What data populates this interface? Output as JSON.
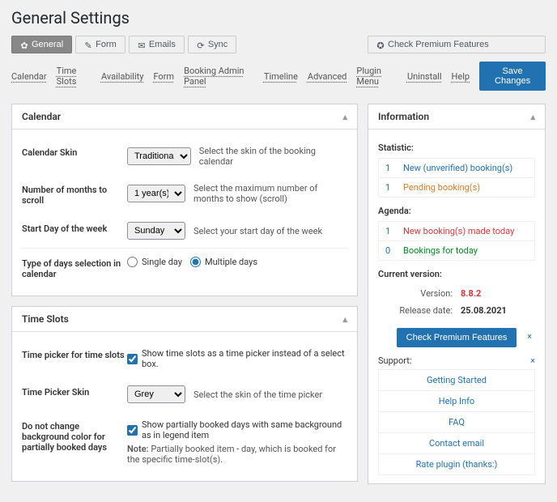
{
  "page_title": "General Settings",
  "tabs": {
    "general": "General",
    "form": "Form",
    "emails": "Emails",
    "sync": "Sync",
    "premium": "Check Premium Features"
  },
  "subnav": [
    "Calendar",
    "Time Slots",
    "Availability",
    "Form",
    "Booking Admin Panel",
    "Timeline",
    "Advanced",
    "Plugin Menu",
    "Uninstall",
    "Help"
  ],
  "save_label": "Save Changes",
  "calendar": {
    "title": "Calendar",
    "skin": {
      "label": "Calendar Skin",
      "value": "Traditional",
      "hint": "Select the skin of the booking calendar"
    },
    "months": {
      "label": "Number of months to scroll",
      "value": "1 year(s)",
      "hint": "Select the maximum number of months to show (scroll)"
    },
    "startday": {
      "label": "Start Day of the week",
      "value": "Sunday",
      "hint": "Select your start day of the week"
    },
    "daytype": {
      "label": "Type of days selection in calendar",
      "opt_single": "Single day",
      "opt_multi": "Multiple days"
    }
  },
  "timeslots": {
    "title": "Time Slots",
    "picker": {
      "label": "Time picker for time slots",
      "desc": "Show time slots as a time picker instead of a select box."
    },
    "skin": {
      "label": "Time Picker Skin",
      "value": "Grey",
      "hint": "Select the skin of the time picker"
    },
    "bg": {
      "label": "Do not change background color for partially booked days",
      "desc": "Show partially booked days with same background as in legend item",
      "note_b": "Note:",
      "note_t": " Partially booked item - day, which is booked for the specific time-slot(s)."
    }
  },
  "info": {
    "title": "Information",
    "stat_h": "Statistic:",
    "stat": [
      {
        "n": "1",
        "t": "New (unverified) booking(s)",
        "c": "blue"
      },
      {
        "n": "1",
        "t": "Pending booking(s)",
        "c": "orange"
      }
    ],
    "agenda_h": "Agenda:",
    "agenda": [
      {
        "n": "1",
        "t": "New booking(s) made today",
        "c": "red"
      },
      {
        "n": "0",
        "t": "Bookings for today",
        "c": "green"
      }
    ],
    "ver_h": "Current version:",
    "ver_l": "Version:",
    "ver_v": "8.8.2",
    "rel_l": "Release date:",
    "rel_v": "25.08.2021",
    "prem_btn": "Check Premium Features",
    "support_h": "Support:",
    "support": [
      "Getting Started",
      "Help Info",
      "FAQ",
      "Contact email",
      "Rate plugin (thanks:)"
    ]
  }
}
